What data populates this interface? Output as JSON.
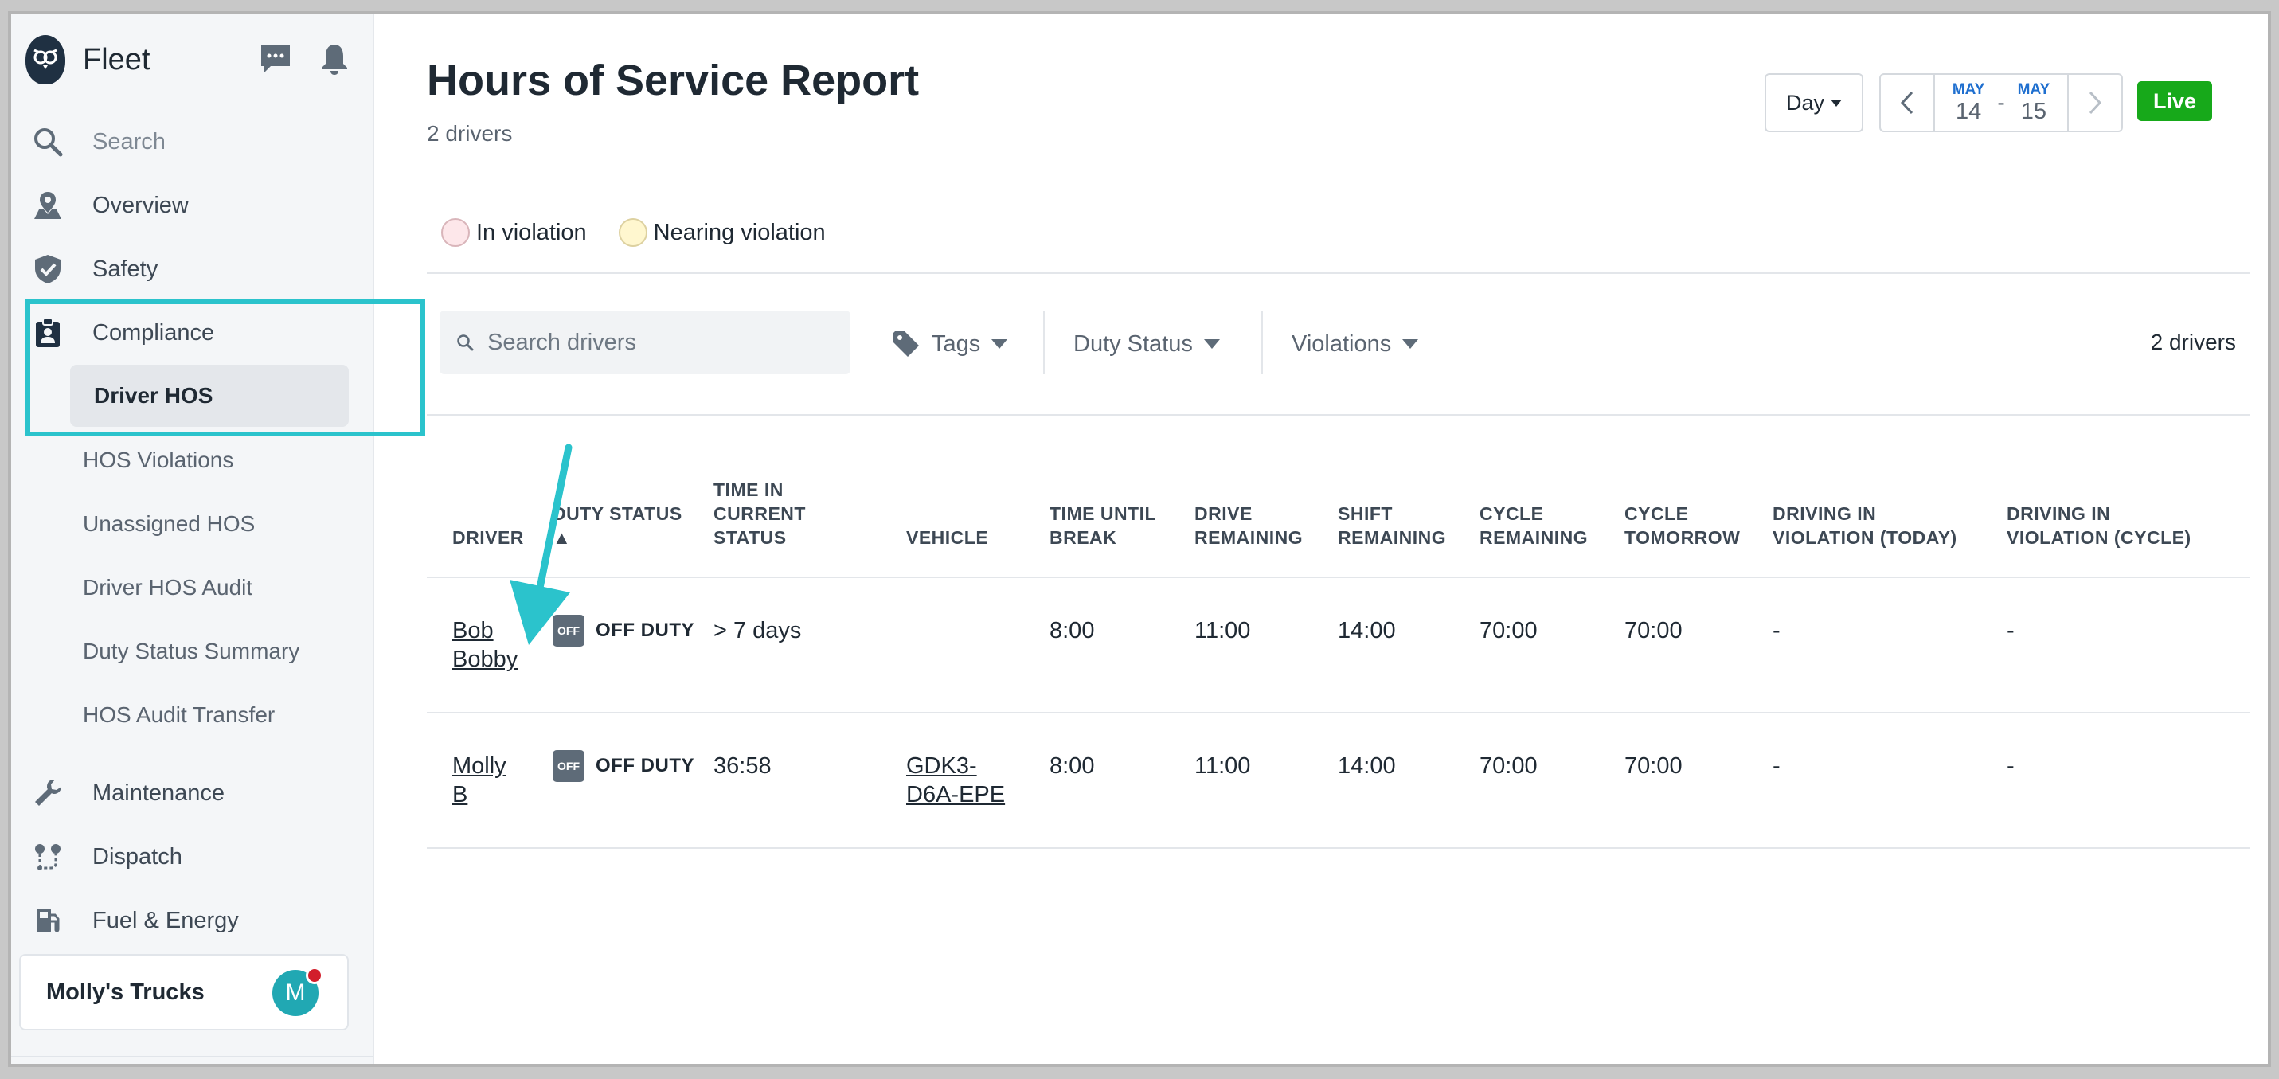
{
  "sidebar": {
    "brand": "Fleet",
    "search_label": "Search",
    "nav": {
      "overview": "Overview",
      "safety": "Safety",
      "compliance": "Compliance",
      "maintenance": "Maintenance",
      "dispatch": "Dispatch",
      "fuel": "Fuel & Energy"
    },
    "compliance_items": [
      "Driver HOS",
      "HOS Violations",
      "Unassigned HOS",
      "Driver HOS Audit",
      "Duty Status Summary",
      "HOS Audit Transfer"
    ],
    "account": {
      "name": "Molly's Trucks",
      "avatar_initial": "M"
    }
  },
  "header": {
    "title": "Hours of Service Report",
    "subtitle": "2 drivers",
    "range_mode": "Day",
    "start": {
      "month": "MAY",
      "day": "14"
    },
    "range_separator": "-",
    "end": {
      "month": "MAY",
      "day": "15"
    },
    "live_label": "Live"
  },
  "legend": {
    "in_violation": "In violation",
    "nearing_violation": "Nearing violation"
  },
  "filters": {
    "search_placeholder": "Search drivers",
    "tags": "Tags",
    "duty_status": "Duty Status",
    "violations": "Violations",
    "count": "2 drivers"
  },
  "table": {
    "headers": {
      "driver": "DRIVER",
      "duty_status_1": "DUTY STATUS",
      "duty_status_2": "▲",
      "time_in_1": "TIME IN",
      "time_in_2": "CURRENT",
      "time_in_3": "STATUS",
      "vehicle": "VEHICLE",
      "time_until_1": "TIME UNTIL",
      "time_until_2": "BREAK",
      "drive_1": "DRIVE",
      "drive_2": "REMAINING",
      "shift_1": "SHIFT",
      "shift_2": "REMAINING",
      "cycle_1": "CYCLE",
      "cycle_2": "REMAINING",
      "cycle_tom_1": "CYCLE",
      "cycle_tom_2": "TOMORROW",
      "dv_today_1": "DRIVING IN",
      "dv_today_2": "VIOLATION (TODAY)",
      "dv_cycle_1": "DRIVING IN",
      "dv_cycle_2": "VIOLATION (CYCLE)"
    },
    "rows": [
      {
        "driver_1": "Bob",
        "driver_2": "Bobby",
        "status_icon": "OFF",
        "status": "OFF DUTY",
        "time_in_status": "> 7 days",
        "vehicle_1": "",
        "vehicle_2": "",
        "time_until_break": "8:00",
        "drive_remaining": "11:00",
        "shift_remaining": "14:00",
        "cycle_remaining": "70:00",
        "cycle_tomorrow": "70:00",
        "dv_today": "-",
        "dv_cycle": "-"
      },
      {
        "driver_1": "Molly",
        "driver_2": "B",
        "status_icon": "OFF",
        "status": "OFF DUTY",
        "time_in_status": "36:58",
        "vehicle_1": "GDK3-",
        "vehicle_2": "D6A-EPE",
        "time_until_break": "8:00",
        "drive_remaining": "11:00",
        "shift_remaining": "14:00",
        "cycle_remaining": "70:00",
        "cycle_tomorrow": "70:00",
        "dv_today": "-",
        "dv_cycle": "-"
      }
    ]
  },
  "colors": {
    "annotation": "#2bc3cc",
    "live": "#17a91a",
    "date_month": "#1f6fcf",
    "sidebar_bg": "#f4f6f8"
  }
}
